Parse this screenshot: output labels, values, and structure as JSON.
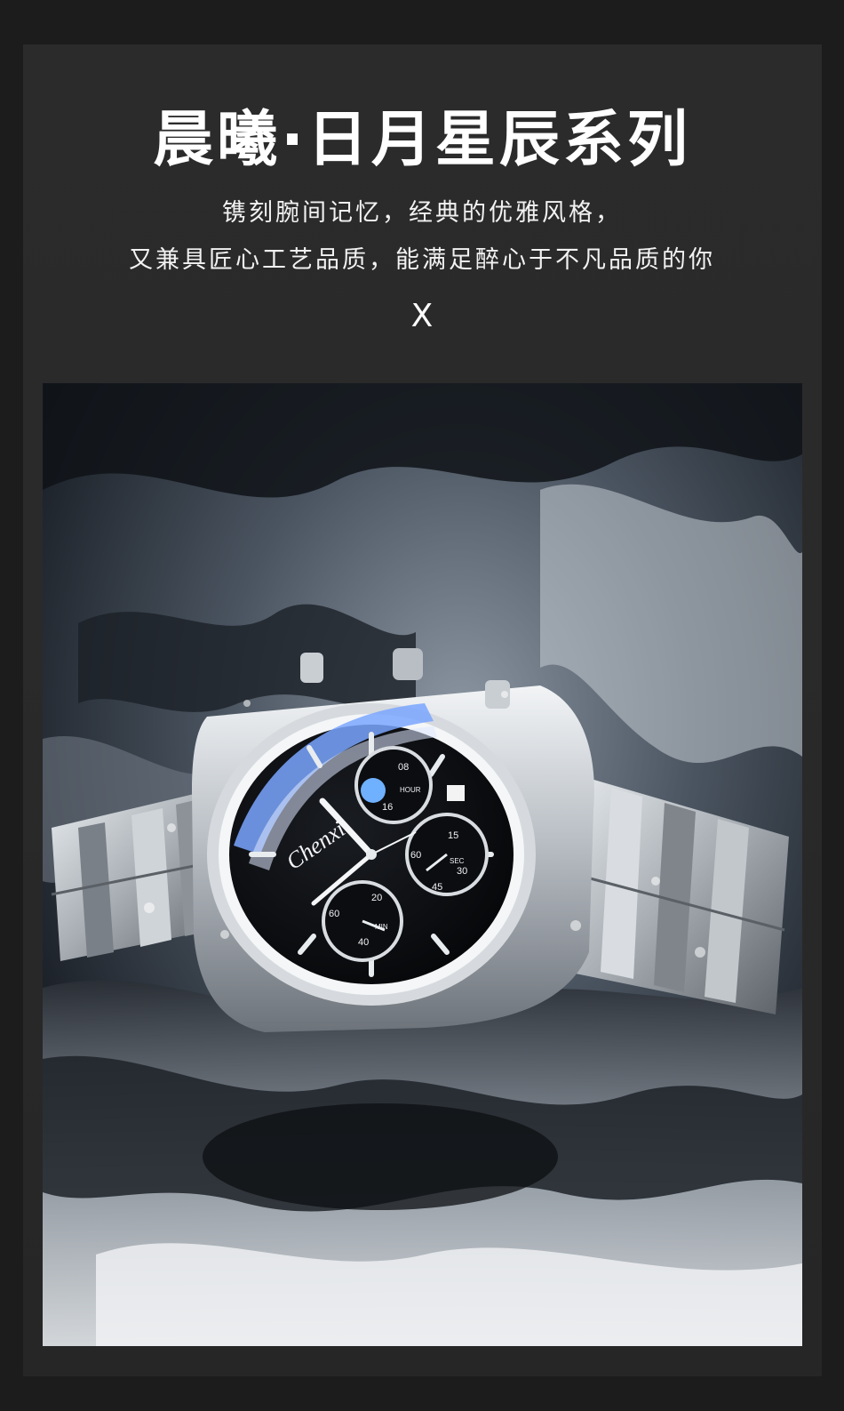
{
  "header": {
    "title": "晨曦·日月星辰系列",
    "subtitle_line1": "镌刻腕间记忆，经典的优雅风格，",
    "subtitle_line2": "又兼具匠心工艺品质，能满足醉心于不凡品质的你",
    "mark": "X"
  },
  "photo": {
    "subject": "watch-product-photo",
    "brand_script": "Chenxi",
    "dial_texts": {
      "hour": "HOUR",
      "sec": "SEC",
      "min": "MIN",
      "n08": "08",
      "n16": "16",
      "n15": "15",
      "n30": "30",
      "n45": "45",
      "n60a": "60",
      "n20": "20",
      "n40": "40",
      "n60b": "60"
    }
  },
  "colors": {
    "page_bg": "#1c1c1c",
    "frame_bg": "#2a2a2a",
    "text": "#ffffff",
    "accent_blue": "#7aa6ff"
  }
}
